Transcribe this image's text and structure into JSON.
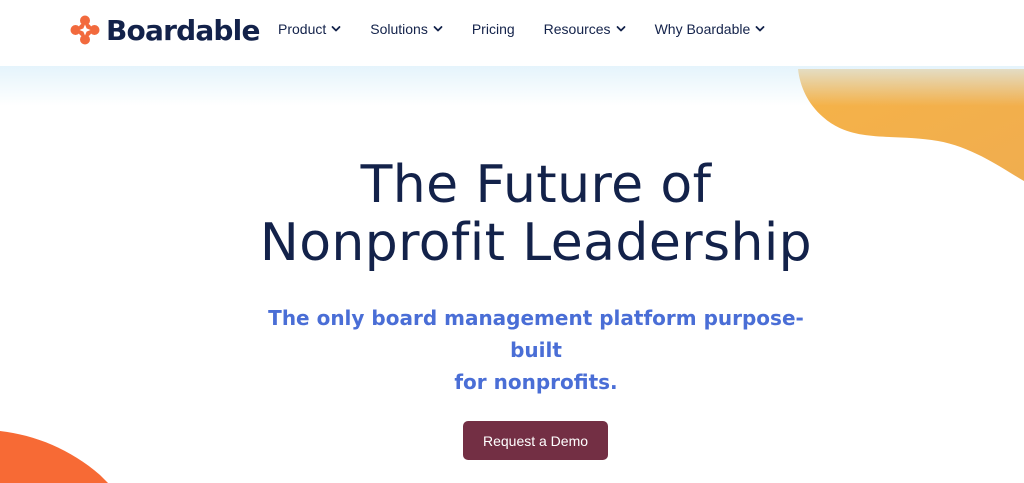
{
  "brand": {
    "name": "Boardable",
    "logo_color": "#f26a3d",
    "text_color": "#13224a"
  },
  "nav": {
    "items": [
      {
        "label": "Product",
        "has_dropdown": true
      },
      {
        "label": "Solutions",
        "has_dropdown": true
      },
      {
        "label": "Pricing",
        "has_dropdown": false
      },
      {
        "label": "Resources",
        "has_dropdown": true
      },
      {
        "label": "Why Boardable",
        "has_dropdown": true
      }
    ]
  },
  "hero": {
    "title_line1": "The Future of",
    "title_line2": "Nonprofit Leadership",
    "subtitle_line1": "The only board management platform purpose-built",
    "subtitle_line2": "for nonprofits.",
    "cta_label": "Request a Demo"
  },
  "colors": {
    "title": "#13224a",
    "subtitle": "#4a6ed6",
    "cta_bg": "#732f44",
    "blob_yellow": "#f3b04a",
    "blob_orange": "#f76a35"
  }
}
